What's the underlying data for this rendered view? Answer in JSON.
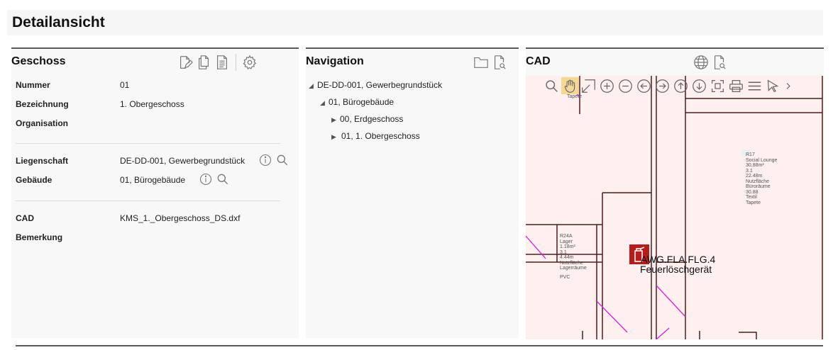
{
  "page": {
    "title": "Detailansicht"
  },
  "geschoss": {
    "title": "Geschoss",
    "icons": [
      "edit-document-icon",
      "copy-icon",
      "document-icon",
      "settings-gear-icon"
    ],
    "fields": {
      "nummer": {
        "label": "Nummer",
        "value": "01"
      },
      "bezeichnung": {
        "label": "Bezeichnung",
        "value": "1. Obergeschoss"
      },
      "organisation": {
        "label": "Organisation",
        "value": ""
      },
      "liegenschaft": {
        "label": "Liegenschaft",
        "value": "DE-DD-001, Gewerbegrundstück"
      },
      "gebaeude": {
        "label": "Gebäude",
        "value": "01, Bürogebäude"
      },
      "cad": {
        "label": "CAD",
        "value": "KMS_1._Obergeschoss_DS.dxf"
      },
      "bemerkung": {
        "label": "Bemerkung",
        "value": ""
      }
    }
  },
  "navigation": {
    "title": "Navigation",
    "icons": [
      "folder-icon",
      "document-search-icon"
    ],
    "tree": {
      "root": {
        "label": "DE-DD-001, Gewerbegrundstück",
        "expanded": true
      },
      "building": {
        "label": "01, Bürogebäude",
        "expanded": true
      },
      "floor0": {
        "label": "00, Erdgeschoss",
        "expanded": false
      },
      "floor1": {
        "label": "01, 1. Obergeschoss",
        "expanded": false,
        "selected": true
      }
    }
  },
  "cad": {
    "title": "CAD",
    "header_icons": [
      "globe-icon",
      "document-search-icon"
    ],
    "toolbar": [
      "zoom-icon",
      "pan-hand-icon",
      "zoom-extents-icon",
      "zoom-in-icon",
      "zoom-out-icon",
      "arrow-left-icon",
      "arrow-right-icon",
      "arrow-up-icon",
      "arrow-down-icon",
      "fullscreen-icon",
      "print-icon",
      "layers-menu-icon",
      "select-pointer-icon",
      "chevron-right-icon"
    ],
    "drawing": {
      "tapete_label": "Tapete",
      "room_r17": "R17\nSocial Lounge\n30,88m²\n3.1\n22.48m\nNutzfläche\nBüroräume\n30.88\nTextil\nTapete",
      "room_r24a": "R24A\nLager\n1.18m²\n3.1\n4.44m\nNutzfläche\nLagerräume",
      "pvc_label": "PVC",
      "extinguisher_code": "AWG.FLA.FLG.4",
      "extinguisher_name": "Feuerlöschgerät"
    },
    "colors": {
      "background": "#fdf0ee",
      "walls": "#4a1e1e",
      "door_swing": "#e01ee0",
      "selection": "#fcce82"
    }
  }
}
